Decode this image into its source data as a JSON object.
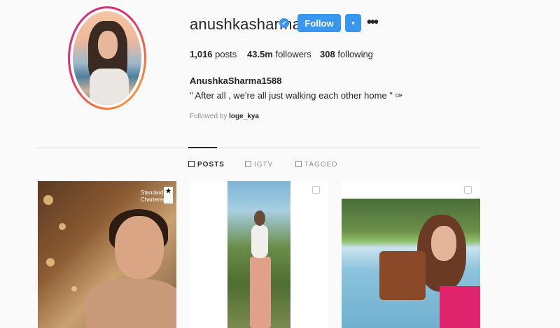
{
  "profile": {
    "username": "anushkasharma",
    "verified_icon": "verified-badge-icon",
    "follow_label": "Follow",
    "dropdown_icon": "▾",
    "more_icon": "•••",
    "stats": {
      "posts_count": "1,016",
      "posts_label": "posts",
      "followers_count": "43.5m",
      "followers_label": "followers",
      "following_count": "308",
      "following_label": "following"
    },
    "full_name": "AnushkaSharma1588",
    "bio": "\" After all , we're all just walking each other home \" ✑",
    "followed_by_prefix": "Followed by",
    "followed_by_user": "loge_kya"
  },
  "tabs": [
    {
      "label": "POSTS",
      "icon": "grid-icon",
      "active": true
    },
    {
      "label": "IGTV",
      "icon": "igtv-icon",
      "active": false
    },
    {
      "label": "TAGGED",
      "icon": "tagged-icon",
      "active": false
    }
  ],
  "posts": [
    {
      "brand_line1": "Standard",
      "brand_line2": "Chartered"
    },
    {
      "multi_icon": "carousel-icon"
    },
    {
      "multi_icon": "carousel-icon"
    }
  ],
  "colors": {
    "accent": "#3897f0",
    "text": "#262626",
    "muted": "#8e8e8e",
    "background": "#fafafa"
  }
}
